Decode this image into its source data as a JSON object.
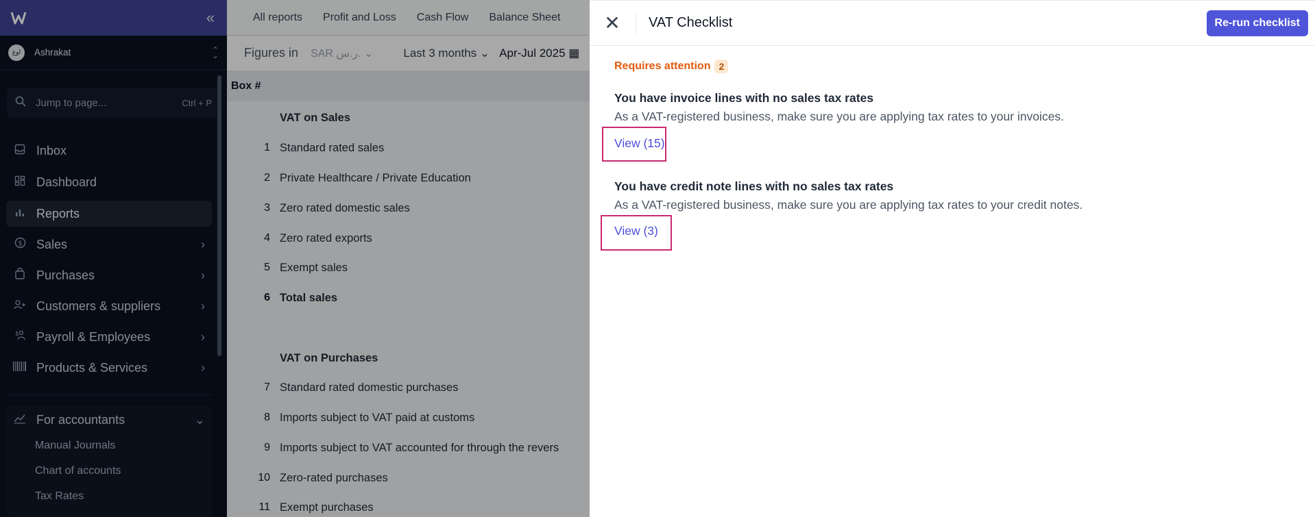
{
  "sidebar": {
    "org_avatar": "اوع",
    "org_name": "Ashrakat",
    "jump_placeholder": "Jump to page...",
    "jump_shortcut": "Ctrl + P",
    "items": [
      {
        "label": "Inbox",
        "icon": "inbox-icon"
      },
      {
        "label": "Dashboard",
        "icon": "dashboard-icon"
      },
      {
        "label": "Reports",
        "icon": "bar-chart-icon"
      },
      {
        "label": "Sales",
        "icon": "dollar-circle-icon"
      },
      {
        "label": "Purchases",
        "icon": "shopping-bag-icon"
      },
      {
        "label": "Customers & suppliers",
        "icon": "users-icon"
      },
      {
        "label": "Payroll & Employees",
        "icon": "payroll-icon"
      },
      {
        "label": "Products & Services",
        "icon": "barcode-icon"
      }
    ],
    "accountants": {
      "label": "For accountants",
      "items": [
        "Manual Journals",
        "Chart of accounts",
        "Tax Rates"
      ]
    }
  },
  "main": {
    "tabs": [
      "All reports",
      "Profit and Loss",
      "Cash Flow",
      "Balance Sheet"
    ],
    "figures_label": "Figures in",
    "currency": "SAR ر.س.",
    "range": "Last 3 months",
    "period": "Apr-Jul 2025",
    "col_header": "Box #",
    "rows": [
      {
        "num": "",
        "text": "VAT on Sales",
        "kind": "sect"
      },
      {
        "num": "1",
        "text": "Standard rated sales",
        "kind": "item"
      },
      {
        "num": "2",
        "text": "Private Healthcare / Private Education",
        "kind": "item"
      },
      {
        "num": "3",
        "text": "Zero rated domestic sales",
        "kind": "item"
      },
      {
        "num": "4",
        "text": "Zero rated exports",
        "kind": "item"
      },
      {
        "num": "5",
        "text": "Exempt sales",
        "kind": "item"
      },
      {
        "num": "6",
        "text": "Total sales",
        "kind": "total"
      },
      {
        "num": "",
        "text": "VAT on Purchases",
        "kind": "sect"
      },
      {
        "num": "7",
        "text": "Standard rated domestic purchases",
        "kind": "item"
      },
      {
        "num": "8",
        "text": "Imports subject to VAT paid at customs",
        "kind": "item"
      },
      {
        "num": "9",
        "text": "Imports subject to VAT accounted for through the revers",
        "kind": "item"
      },
      {
        "num": "10",
        "text": "Zero-rated purchases",
        "kind": "item"
      },
      {
        "num": "11",
        "text": "Exempt purchases",
        "kind": "item"
      }
    ]
  },
  "drawer": {
    "title": "VAT Checklist",
    "rerun_label": "Re-run checklist",
    "attention_label": "Requires attention",
    "attention_count": "2",
    "issues": [
      {
        "title": "You have invoice lines with no sales tax rates",
        "desc": "As a VAT-registered business, make sure you are applying tax rates to your invoices.",
        "link": "View (15)"
      },
      {
        "title": "You have credit note lines with no sales tax rates",
        "desc": "As a VAT-registered business, make sure you are applying tax rates to your credit notes.",
        "link": "View (3)"
      }
    ]
  },
  "colors": {
    "accent": "#4f55d8",
    "attention": "#e05a0c",
    "highlight": "#c9296f",
    "sidebar_bg": "#0b1120"
  }
}
